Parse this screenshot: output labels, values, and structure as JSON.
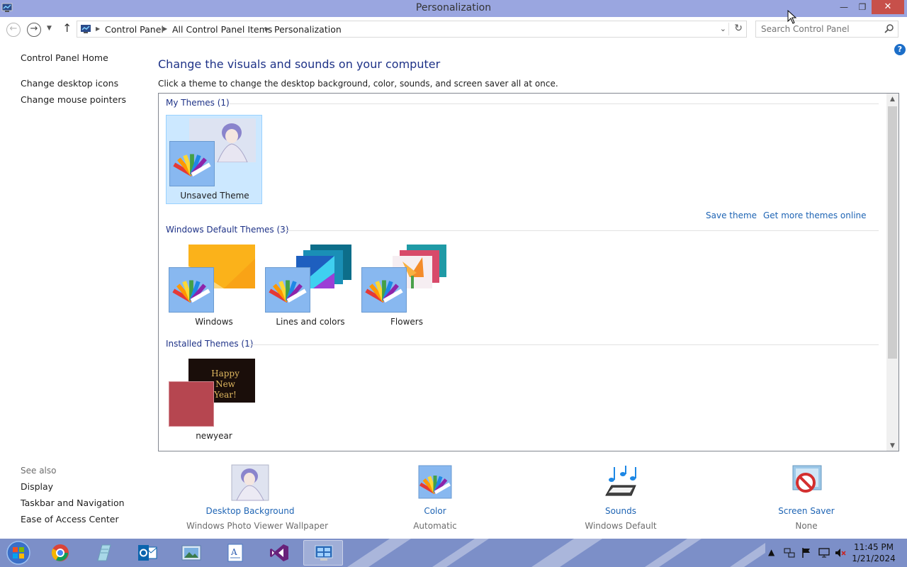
{
  "window": {
    "title": "Personalization"
  },
  "address": {
    "crumbs": [
      "Control Panel",
      "All Control Panel Items",
      "Personalization"
    ],
    "search_placeholder": "Search Control Panel"
  },
  "left_nav": {
    "home": "Control Panel Home",
    "items": [
      "Change desktop icons",
      "Change mouse pointers"
    ],
    "see_also_label": "See also",
    "see_also": [
      "Display",
      "Taskbar and Navigation",
      "Ease of Access Center"
    ]
  },
  "main": {
    "heading": "Change the visuals and sounds on your computer",
    "subheading": "Click a theme to change the desktop background, color, sounds, and screen saver all at once.",
    "sections": [
      {
        "title": "My Themes (1)",
        "themes": [
          {
            "label": "Unsaved Theme",
            "selected": true
          }
        ]
      },
      {
        "title": "Windows Default Themes (3)",
        "themes": [
          {
            "label": "Windows"
          },
          {
            "label": "Lines and colors"
          },
          {
            "label": "Flowers"
          }
        ]
      },
      {
        "title": "Installed Themes (1)",
        "themes": [
          {
            "label": "newyear",
            "thumb_text": "Happy New Year!"
          }
        ]
      }
    ],
    "links": {
      "save_theme": "Save theme",
      "get_more": "Get more themes online"
    }
  },
  "bottom": [
    {
      "label": "Desktop Background",
      "value": "Windows Photo Viewer Wallpaper",
      "icon": "desktop-background-icon"
    },
    {
      "label": "Color",
      "value": "Automatic",
      "icon": "color-palette-icon"
    },
    {
      "label": "Sounds",
      "value": "Windows Default",
      "icon": "sounds-icon"
    },
    {
      "label": "Screen Saver",
      "value": "None",
      "icon": "screen-saver-icon"
    }
  ],
  "taskbar": {
    "apps": [
      "chrome-icon",
      "notepad-icon",
      "outlook-icon",
      "photos-icon",
      "wordpad-icon",
      "visual-studio-icon",
      "control-panel-icon"
    ],
    "clock_time": "11:45 PM",
    "clock_date": "1/21/2024"
  },
  "colors": {
    "titlebar": "#9aa6e0",
    "close_button": "#c7504a",
    "heading": "#1e3287",
    "link": "#1e64b4",
    "selection": "#cce8ff",
    "taskbar": "#7c8fc8"
  }
}
